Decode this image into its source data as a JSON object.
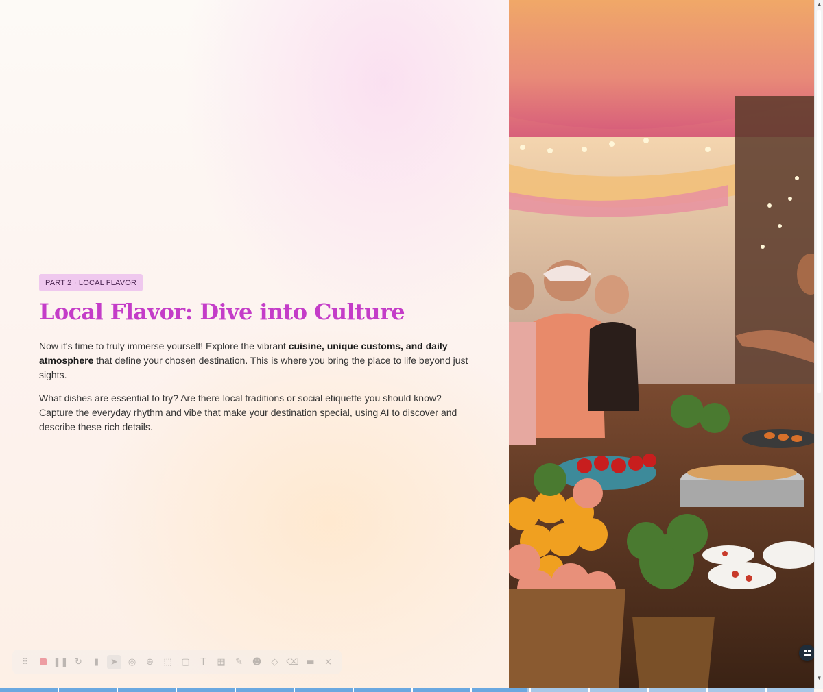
{
  "slide": {
    "tag": "PART 2 · LOCAL FLAVOR",
    "title": "Local Flavor: Dive into Culture",
    "para1_start": "Now it's time to truly immerse yourself! Explore the vibrant ",
    "para1_bold": "cuisine, unique customs, and daily atmosphere",
    "para1_end": " that define your chosen destination. This is where you bring the place to life beyond just sights.",
    "para2": "What dishes are essential to try? Are there local traditions or social etiquette you should know? Capture the everyday rhythm and vibe that make your destination special, using AI to discover and describe these rich details."
  },
  "photo": {
    "icon": "market-photo"
  },
  "toolbar": {
    "tools": [
      "drag-handle-icon",
      "record-icon",
      "pause-icon",
      "restart-icon",
      "delete-icon",
      "pointer-icon",
      "highlight-cursor-icon",
      "zoom-icon",
      "select-icon",
      "shape-icon",
      "text-icon",
      "grid-icon",
      "pen-icon",
      "emoji-icon",
      "eraser-icon",
      "clear-icon",
      "camera-icon",
      "close-icon"
    ]
  },
  "progress": {
    "fraction": 0.648
  },
  "colors": {
    "title": "#c43dc8",
    "tag_bg": "#efc8ee",
    "progress": "#6aa8e0"
  }
}
